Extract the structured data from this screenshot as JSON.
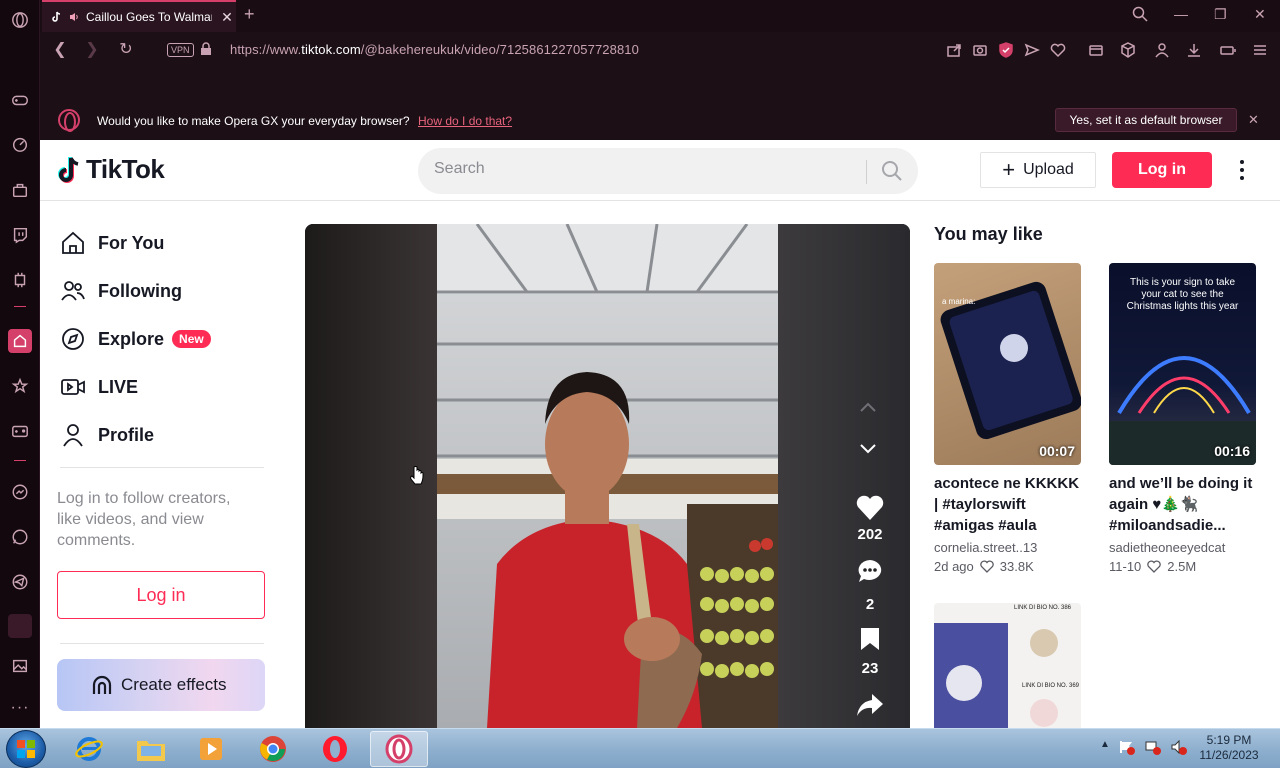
{
  "browser": {
    "tab_title": "Caillou Goes To Walmart",
    "url_prefix": "https://www.",
    "url_domain": "tiktok.com",
    "url_path": "/@bakehereukuk/video/7125861227057728810",
    "vpn_label": "VPN",
    "default_prompt": {
      "message": "Would you like to make Opera GX your everyday browser?",
      "link": "How do I do that?",
      "button": "Yes, set it as default browser"
    }
  },
  "tiktok": {
    "logo_text": "TikTok",
    "search_placeholder": "Search",
    "upload_label": "Upload",
    "login_label": "Log in",
    "nav": [
      {
        "label": "For You",
        "icon": "home-icon"
      },
      {
        "label": "Following",
        "icon": "people-icon"
      },
      {
        "label": "Explore",
        "icon": "compass-icon",
        "badge": "New"
      },
      {
        "label": "LIVE",
        "icon": "live-icon"
      },
      {
        "label": "Profile",
        "icon": "profile-icon"
      }
    ],
    "login_hint": "Log in to follow creators, like videos, and view comments.",
    "sidebar_login": "Log in",
    "create_effects": "Create effects",
    "video_stats": {
      "likes": "202",
      "comments": "2",
      "saves": "23"
    },
    "recommendations_title": "You may like",
    "recommendations": [
      {
        "duration": "00:07",
        "desc": "acontece ne KKKKK | #taylorswift #amigas #aula #escola...",
        "author": "cornelia.street..13",
        "date": "2d ago",
        "likes": "33.8K",
        "overlay": "a marina:"
      },
      {
        "duration": "00:16",
        "desc": "and we’ll be doing it again ♥︎🎄🐈‍⬛ #miloandsadie...",
        "author": "sadietheoneeyedcat",
        "date": "11-10",
        "likes": "2.5M",
        "overlay": "This is your sign to take your cat to see the Christmas lights this year"
      },
      {
        "overlay_top": "LINK DI BIO NO. 386",
        "overlay_bottom": "LINK DI BIO NO. 369"
      }
    ]
  },
  "taskbar": {
    "time": "5:19 PM",
    "date": "11/26/2023"
  }
}
